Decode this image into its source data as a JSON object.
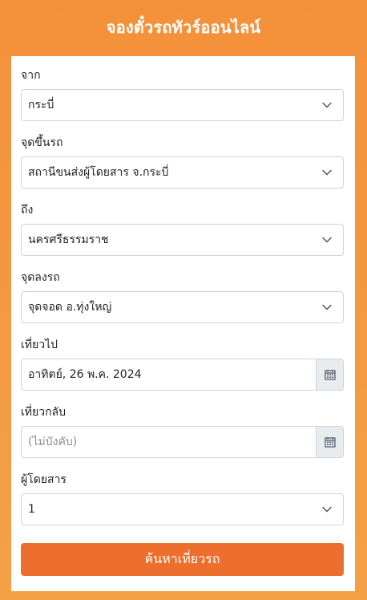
{
  "header": {
    "title": "จองตั๋วรถทัวร์ออนไลน์"
  },
  "form": {
    "from": {
      "label": "จาก",
      "value": "กระบี่"
    },
    "pickup": {
      "label": "จุดขึ้นรถ",
      "value": "สถานีขนส่งผู้โดยสาร จ.กระบี่"
    },
    "to": {
      "label": "ถึง",
      "value": "นครศรีธรรมราช"
    },
    "dropoff": {
      "label": "จุดลงรถ",
      "value": "จุดจอด อ.ทุ่งใหญ่"
    },
    "departure": {
      "label": "เที่ยวไป",
      "value": "อาทิตย์, 26 พ.ค. 2024"
    },
    "return": {
      "label": "เที่ยวกลับ",
      "value": "",
      "placeholder": "(ไม่บังคับ)"
    },
    "passengers": {
      "label": "ผู้โดยสาร",
      "value": "1"
    },
    "submit_label": "ค้นหาเที่ยวรถ"
  },
  "icons": {
    "select": "chevron-down-icon",
    "date": "calendar-icon"
  },
  "colors": {
    "background": "#f39a3c",
    "header_text": "#ffffff",
    "button": "#ee6f2d",
    "border": "#cfd4da",
    "calendar_addon": "#e9ecef"
  }
}
